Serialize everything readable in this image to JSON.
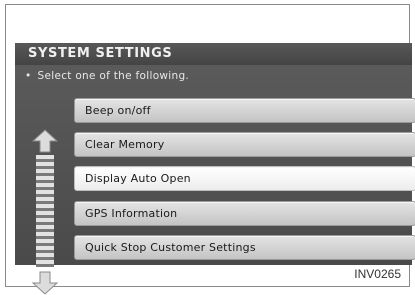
{
  "screen": {
    "title": "SYSTEM SETTINGS",
    "instruction_bullet": "•",
    "instruction": "Select one of the following."
  },
  "menu": {
    "items": [
      {
        "label": "Beep on/off",
        "selected": false
      },
      {
        "label": "Clear Memory",
        "selected": false
      },
      {
        "label": "Display Auto Open",
        "selected": true
      },
      {
        "label": "GPS Information",
        "selected": false
      },
      {
        "label": "Quick Stop Customer Settings",
        "selected": false
      }
    ]
  },
  "figure_code": "INV0265",
  "icons": {
    "scroll_up": "arrow-up-icon",
    "scroll_down": "arrow-down-icon"
  },
  "colors": {
    "screen_background": "#4a4a4a",
    "button_face": "#d8d8d8",
    "selected_button_face": "#ffffff",
    "title_text": "#f0f0f0"
  }
}
